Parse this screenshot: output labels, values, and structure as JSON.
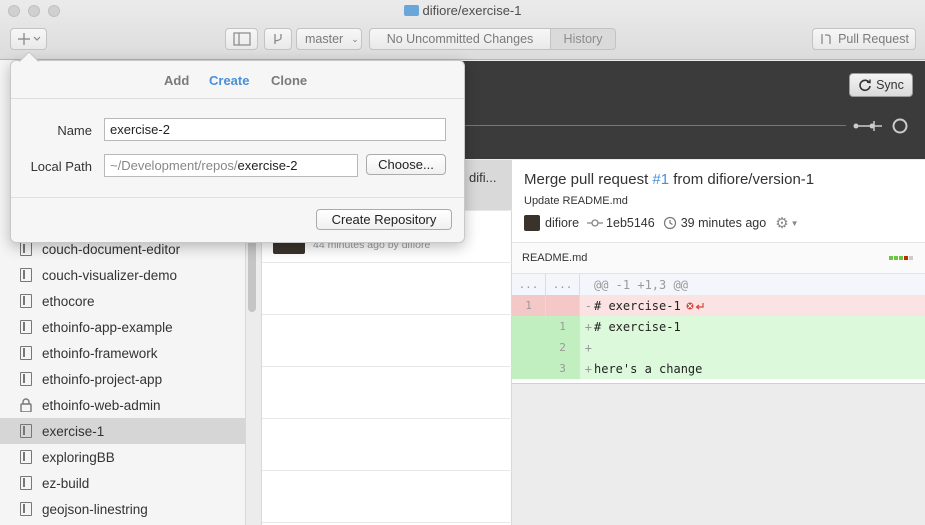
{
  "window": {
    "title": "difiore/exercise-1"
  },
  "toolbar": {
    "add_icon": "plus-icon",
    "branch": "master",
    "uncommitted": "No Uncommitted Changes",
    "history": "History",
    "pull_request": "Pull Request"
  },
  "popover": {
    "tabs": [
      "Add",
      "Create",
      "Clone"
    ],
    "active_tab": "Create",
    "name_label": "Name",
    "name_value": "exercise-2",
    "path_label": "Local Path",
    "path_prefix": "~/Development/repos/",
    "path_suffix": "exercise-2",
    "choose_label": "Choose...",
    "create_label": "Create Repository"
  },
  "sidebar": {
    "repos": [
      {
        "name": "couch-document-editor",
        "icon": "repo-icon"
      },
      {
        "name": "couch-visualizer-demo",
        "icon": "repo-icon"
      },
      {
        "name": "ethocore",
        "icon": "repo-icon"
      },
      {
        "name": "ethoinfo-app-example",
        "icon": "repo-icon"
      },
      {
        "name": "ethoinfo-framework",
        "icon": "repo-icon"
      },
      {
        "name": "ethoinfo-project-app",
        "icon": "repo-icon"
      },
      {
        "name": "ethoinfo-web-admin",
        "icon": "lock-icon"
      },
      {
        "name": "exercise-1",
        "icon": "repo-icon",
        "selected": true
      },
      {
        "name": "exploringBB",
        "icon": "repo-icon"
      },
      {
        "name": "ez-build",
        "icon": "repo-icon"
      },
      {
        "name": "geojson-linestring",
        "icon": "repo-icon"
      }
    ]
  },
  "header": {
    "sync_label": "Sync"
  },
  "history": {
    "selected_truncated": "difi...",
    "second_meta": "44 minutes ago by difiore"
  },
  "commit": {
    "title_pre": "Merge pull request ",
    "title_link": "#1",
    "title_post": " from difiore/version-1",
    "subtitle": "Update README.md",
    "author": "difiore",
    "sha": "1eb5146",
    "time": "39 minutes ago"
  },
  "diff": {
    "file": "README.md",
    "hunk": "@@ -1 +1,3 @@",
    "ellipsis": "...",
    "lines": [
      {
        "old": "1",
        "new": "",
        "sign": "-",
        "text": "# exercise-1",
        "kind": "del"
      },
      {
        "old": "",
        "new": "1",
        "sign": "+",
        "text": "# exercise-1",
        "kind": "add"
      },
      {
        "old": "",
        "new": "2",
        "sign": "+",
        "text": "",
        "kind": "add"
      },
      {
        "old": "",
        "new": "3",
        "sign": "+",
        "text": "here's a change",
        "kind": "add"
      }
    ]
  },
  "colors": {
    "accent": "#4a90d9",
    "del_bg": "#fbe3e3",
    "add_bg": "#dcfadb",
    "dark_band": "#3b3b3b"
  }
}
